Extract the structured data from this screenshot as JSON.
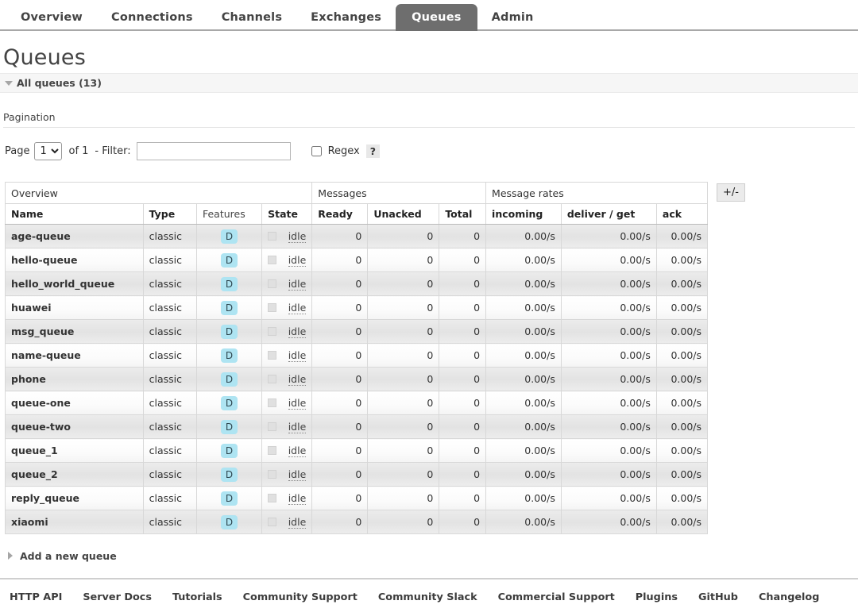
{
  "nav": {
    "tabs": [
      {
        "label": "Overview",
        "active": false
      },
      {
        "label": "Connections",
        "active": false
      },
      {
        "label": "Channels",
        "active": false
      },
      {
        "label": "Exchanges",
        "active": false
      },
      {
        "label": "Queues",
        "active": true
      },
      {
        "label": "Admin",
        "active": false
      }
    ]
  },
  "page": {
    "title": "Queues",
    "section_label": "All queues (13)",
    "pagination_heading": "Pagination",
    "add_queue_label": "Add a new queue"
  },
  "pagination": {
    "page_label": "Page",
    "page_value": "1",
    "page_options": [
      "1"
    ],
    "of_text": "of 1",
    "filter_label": "- Filter:",
    "filter_value": "",
    "filter_placeholder": "",
    "regex_label": "Regex",
    "regex_checked": false,
    "help_label": "?"
  },
  "table": {
    "group_headers": [
      {
        "label": "Overview",
        "colspan": 4
      },
      {
        "label": "Messages",
        "colspan": 3
      },
      {
        "label": "Message rates",
        "colspan": 3
      }
    ],
    "columns": [
      {
        "label": "Name",
        "bold": true
      },
      {
        "label": "Type",
        "bold": true
      },
      {
        "label": "Features",
        "bold": false
      },
      {
        "label": "State",
        "bold": true
      },
      {
        "label": "Ready",
        "bold": true
      },
      {
        "label": "Unacked",
        "bold": true
      },
      {
        "label": "Total",
        "bold": true
      },
      {
        "label": "incoming",
        "bold": true
      },
      {
        "label": "deliver / get",
        "bold": true
      },
      {
        "label": "ack",
        "bold": true
      }
    ],
    "toggle_columns_label": "+/-",
    "rows": [
      {
        "name": "age-queue",
        "type": "classic",
        "features": "D",
        "state": "idle",
        "ready": "0",
        "unacked": "0",
        "total": "0",
        "incoming": "0.00/s",
        "deliver_get": "0.00/s",
        "ack": "0.00/s"
      },
      {
        "name": "hello-queue",
        "type": "classic",
        "features": "D",
        "state": "idle",
        "ready": "0",
        "unacked": "0",
        "total": "0",
        "incoming": "0.00/s",
        "deliver_get": "0.00/s",
        "ack": "0.00/s"
      },
      {
        "name": "hello_world_queue",
        "type": "classic",
        "features": "D",
        "state": "idle",
        "ready": "0",
        "unacked": "0",
        "total": "0",
        "incoming": "0.00/s",
        "deliver_get": "0.00/s",
        "ack": "0.00/s"
      },
      {
        "name": "huawei",
        "type": "classic",
        "features": "D",
        "state": "idle",
        "ready": "0",
        "unacked": "0",
        "total": "0",
        "incoming": "0.00/s",
        "deliver_get": "0.00/s",
        "ack": "0.00/s"
      },
      {
        "name": "msg_queue",
        "type": "classic",
        "features": "D",
        "state": "idle",
        "ready": "0",
        "unacked": "0",
        "total": "0",
        "incoming": "0.00/s",
        "deliver_get": "0.00/s",
        "ack": "0.00/s"
      },
      {
        "name": "name-queue",
        "type": "classic",
        "features": "D",
        "state": "idle",
        "ready": "0",
        "unacked": "0",
        "total": "0",
        "incoming": "0.00/s",
        "deliver_get": "0.00/s",
        "ack": "0.00/s"
      },
      {
        "name": "phone",
        "type": "classic",
        "features": "D",
        "state": "idle",
        "ready": "0",
        "unacked": "0",
        "total": "0",
        "incoming": "0.00/s",
        "deliver_get": "0.00/s",
        "ack": "0.00/s"
      },
      {
        "name": "queue-one",
        "type": "classic",
        "features": "D",
        "state": "idle",
        "ready": "0",
        "unacked": "0",
        "total": "0",
        "incoming": "0.00/s",
        "deliver_get": "0.00/s",
        "ack": "0.00/s"
      },
      {
        "name": "queue-two",
        "type": "classic",
        "features": "D",
        "state": "idle",
        "ready": "0",
        "unacked": "0",
        "total": "0",
        "incoming": "0.00/s",
        "deliver_get": "0.00/s",
        "ack": "0.00/s"
      },
      {
        "name": "queue_1",
        "type": "classic",
        "features": "D",
        "state": "idle",
        "ready": "0",
        "unacked": "0",
        "total": "0",
        "incoming": "0.00/s",
        "deliver_get": "0.00/s",
        "ack": "0.00/s"
      },
      {
        "name": "queue_2",
        "type": "classic",
        "features": "D",
        "state": "idle",
        "ready": "0",
        "unacked": "0",
        "total": "0",
        "incoming": "0.00/s",
        "deliver_get": "0.00/s",
        "ack": "0.00/s"
      },
      {
        "name": "reply_queue",
        "type": "classic",
        "features": "D",
        "state": "idle",
        "ready": "0",
        "unacked": "0",
        "total": "0",
        "incoming": "0.00/s",
        "deliver_get": "0.00/s",
        "ack": "0.00/s"
      },
      {
        "name": "xiaomi",
        "type": "classic",
        "features": "D",
        "state": "idle",
        "ready": "0",
        "unacked": "0",
        "total": "0",
        "incoming": "0.00/s",
        "deliver_get": "0.00/s",
        "ack": "0.00/s"
      }
    ]
  },
  "footer": {
    "links": [
      "HTTP API",
      "Server Docs",
      "Tutorials",
      "Community Support",
      "Community Slack",
      "Commercial Support",
      "Plugins",
      "GitHub",
      "Changelog"
    ]
  },
  "colors": {
    "active_tab_bg": "#6e6e6e",
    "feature_badge_bg": "#aee4f2",
    "band_bg": "#f6f6f6",
    "row_odd_bg": "#e6e6e6"
  }
}
